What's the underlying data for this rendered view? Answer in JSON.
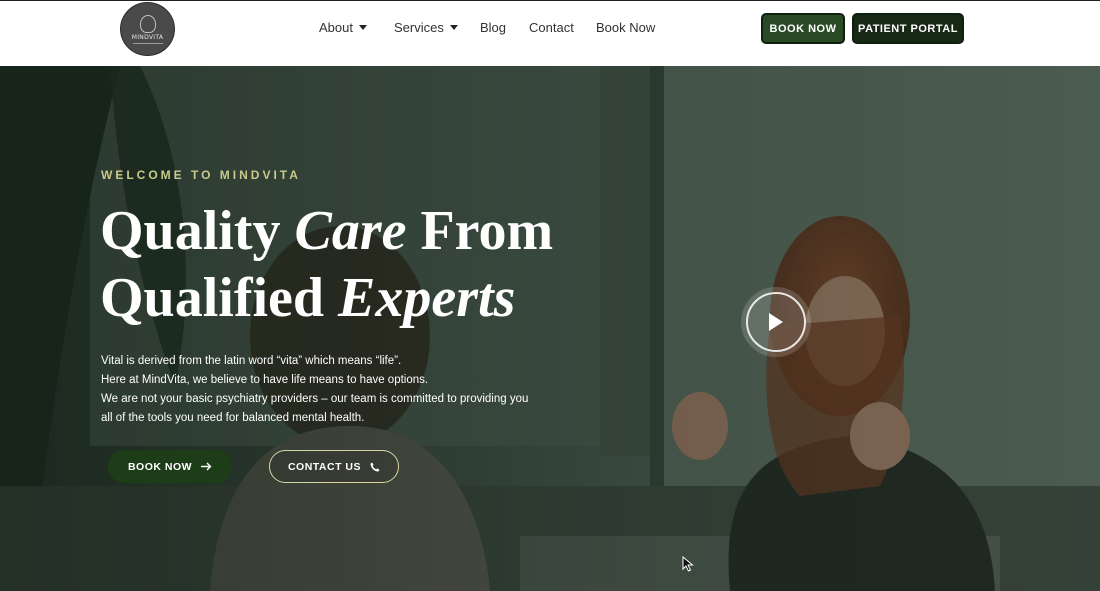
{
  "logo": {
    "word": "MINDVITA"
  },
  "nav": {
    "items": [
      {
        "label": "About",
        "dropdown": true
      },
      {
        "label": "Services",
        "dropdown": true
      },
      {
        "label": "Blog",
        "dropdown": false
      },
      {
        "label": "Contact",
        "dropdown": false
      },
      {
        "label": "Book Now",
        "dropdown": false
      }
    ]
  },
  "header_buttons": {
    "book": "BOOK NOW",
    "portal": "PATIENT PORTAL"
  },
  "hero": {
    "eyebrow": "WELCOME TO MINDVITA",
    "headline": {
      "w1": "Quality ",
      "w2": "Care",
      "w3": " From",
      "w4": "Qualified ",
      "w5": "Experts"
    },
    "paragraph": [
      "Vital is derived from the latin word “vita” which means “life”.",
      "Here at MindVita, we believe to have life means to have options.",
      "We are not your basic psychiatry providers – our team is committed to providing you",
      "all of the tools you need for balanced mental health."
    ],
    "cta_book": "BOOK NOW",
    "cta_contact": "CONTACT US"
  },
  "colors": {
    "brand_dark": "#172915",
    "brand_green": "#2a4a26",
    "accent_gold": "#c9c98a"
  },
  "icons": [
    "arrow-right-icon",
    "phone-icon",
    "play-icon",
    "caret-down-icon"
  ]
}
